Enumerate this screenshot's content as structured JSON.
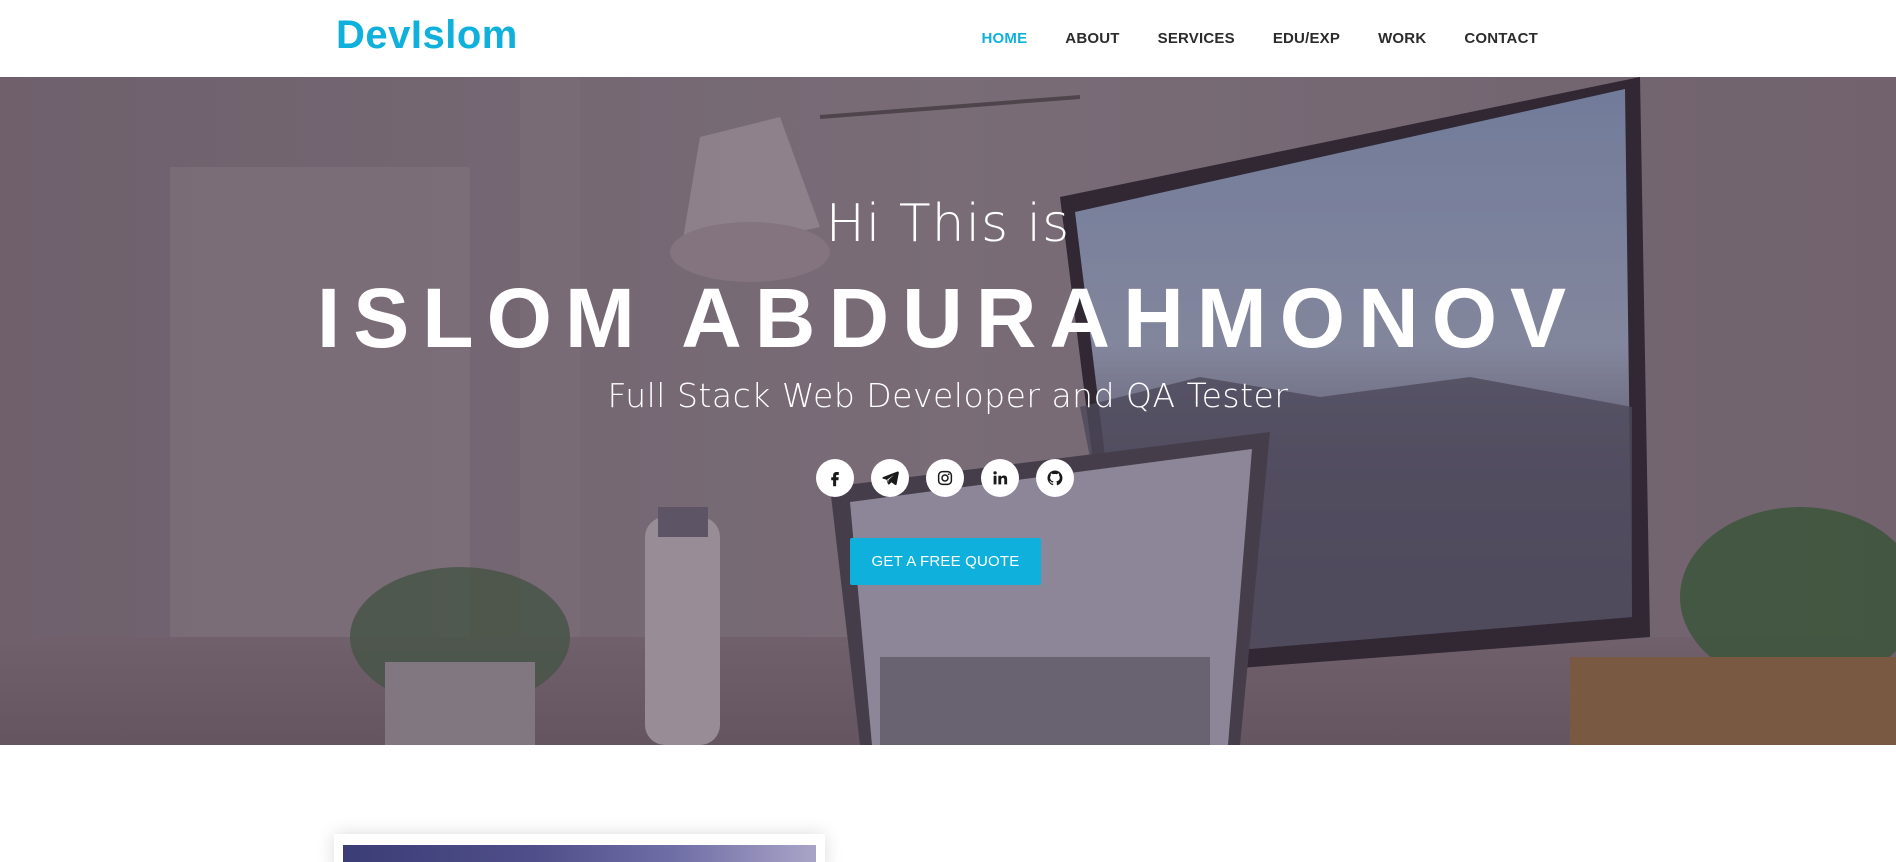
{
  "brand": {
    "name": "DevIslom",
    "color": "#0fb1dc"
  },
  "nav": {
    "items": [
      {
        "label": "HOME",
        "active": true
      },
      {
        "label": "ABOUT",
        "active": false
      },
      {
        "label": "SERVICES",
        "active": false
      },
      {
        "label": "EDU/EXP",
        "active": false
      },
      {
        "label": "WORK",
        "active": false
      },
      {
        "label": "CONTACT",
        "active": false
      }
    ]
  },
  "hero": {
    "greeting": "Hi This is",
    "name": "ISLOM ABDURAHMONOV",
    "role": "Full Stack Web Developer and QA Tester",
    "socials": [
      {
        "icon": "facebook-icon"
      },
      {
        "icon": "telegram-icon"
      },
      {
        "icon": "instagram-icon"
      },
      {
        "icon": "linkedin-icon"
      },
      {
        "icon": "github-icon"
      }
    ],
    "cta_label": "GET A FREE QUOTE"
  },
  "colors": {
    "accent": "#0fb1dc",
    "text_dark": "#2b2b2b",
    "white": "#ffffff"
  }
}
